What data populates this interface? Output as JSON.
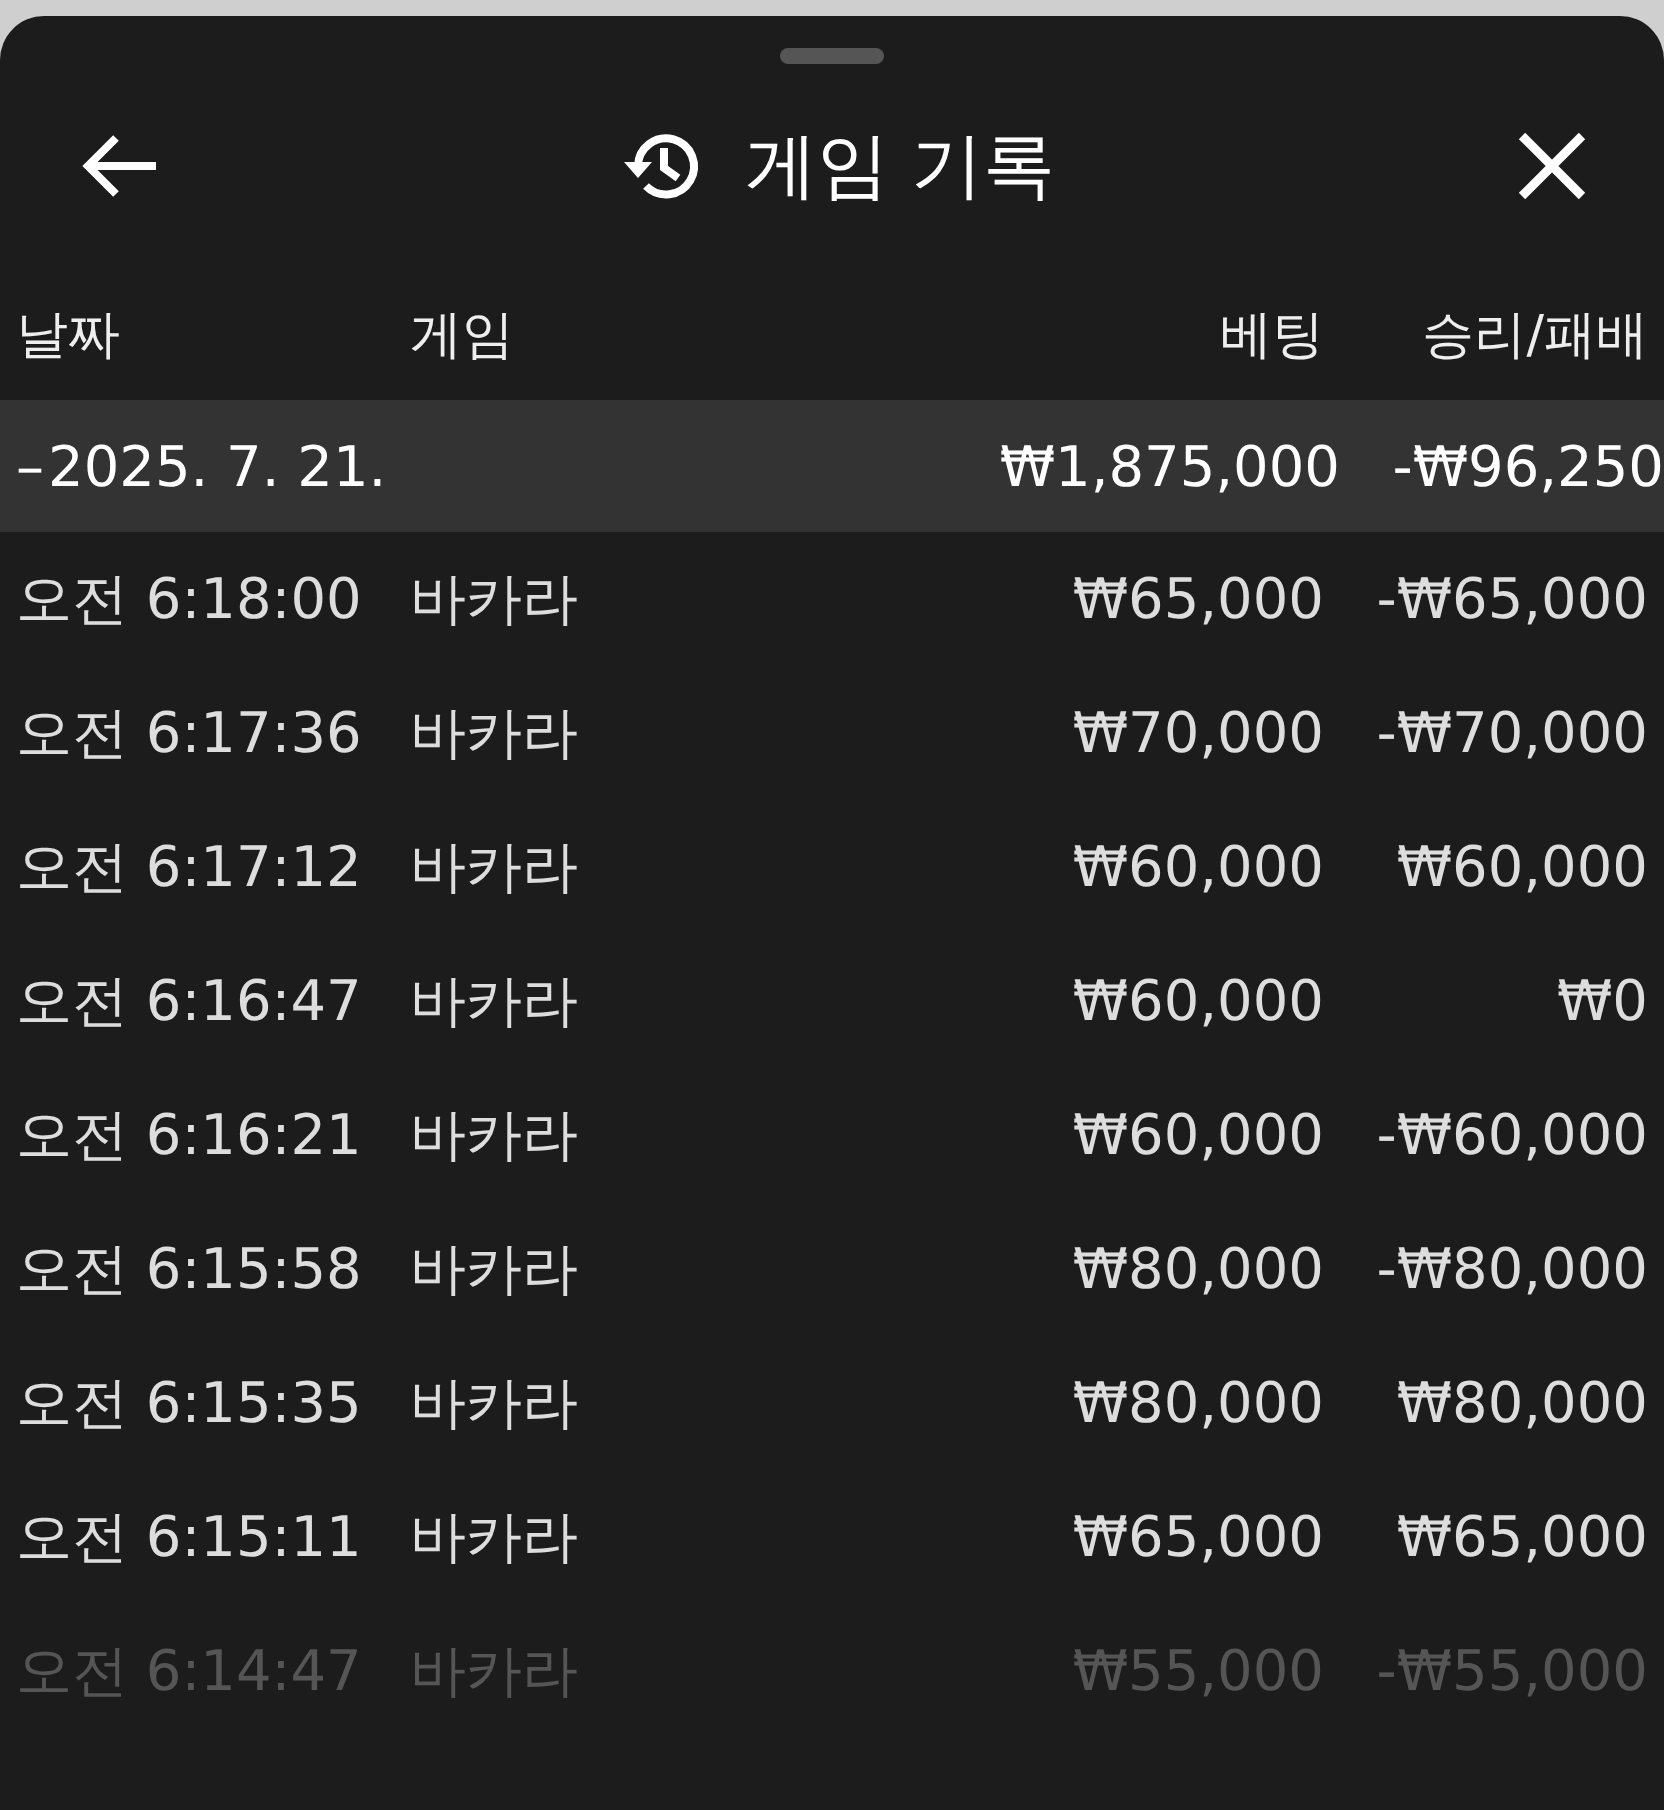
{
  "header": {
    "title": "게임 기록"
  },
  "columns": [
    "날짜",
    "게임",
    "베팅",
    "승리/패배"
  ],
  "group": {
    "toggle": "–",
    "date": "2025. 7. 21.",
    "bet": "₩1,875,000",
    "result": "-₩96,250"
  },
  "rows": [
    {
      "time": "오전 6:18:00",
      "game": "바카라",
      "bet": "₩65,000",
      "result": "-₩65,000"
    },
    {
      "time": "오전 6:17:36",
      "game": "바카라",
      "bet": "₩70,000",
      "result": "-₩70,000"
    },
    {
      "time": "오전 6:17:12",
      "game": "바카라",
      "bet": "₩60,000",
      "result": "₩60,000"
    },
    {
      "time": "오전 6:16:47",
      "game": "바카라",
      "bet": "₩60,000",
      "result": "₩0"
    },
    {
      "time": "오전 6:16:21",
      "game": "바카라",
      "bet": "₩60,000",
      "result": "-₩60,000"
    },
    {
      "time": "오전 6:15:58",
      "game": "바카라",
      "bet": "₩80,000",
      "result": "-₩80,000"
    },
    {
      "time": "오전 6:15:35",
      "game": "바카라",
      "bet": "₩80,000",
      "result": "₩80,000"
    },
    {
      "time": "오전 6:15:11",
      "game": "바카라",
      "bet": "₩65,000",
      "result": "₩65,000"
    },
    {
      "time": "오전 6:14:47",
      "game": "바카라",
      "bet": "₩55,000",
      "result": "-₩55,000"
    }
  ]
}
